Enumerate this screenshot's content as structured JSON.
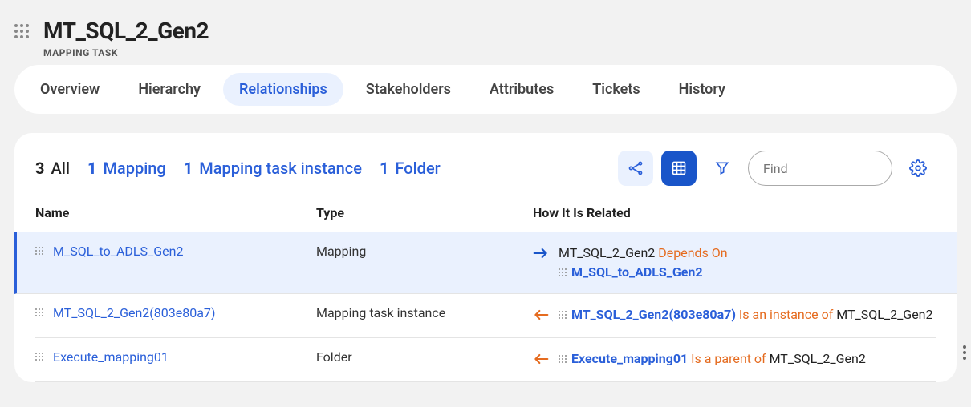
{
  "header": {
    "title": "MT_SQL_2_Gen2",
    "subtitle": "MAPPING TASK"
  },
  "tabs": [
    {
      "label": "Overview",
      "active": false
    },
    {
      "label": "Hierarchy",
      "active": false
    },
    {
      "label": "Relationships",
      "active": true
    },
    {
      "label": "Stakeholders",
      "active": false
    },
    {
      "label": "Attributes",
      "active": false
    },
    {
      "label": "Tickets",
      "active": false
    },
    {
      "label": "History",
      "active": false
    }
  ],
  "counters": [
    {
      "num": "3",
      "label": "All",
      "blue": false
    },
    {
      "num": "1",
      "label": "Mapping",
      "blue": true
    },
    {
      "num": "1",
      "label": "Mapping task instance",
      "blue": true
    },
    {
      "num": "1",
      "label": "Folder",
      "blue": true
    }
  ],
  "search": {
    "placeholder": "Find"
  },
  "columns": {
    "c1": "Name",
    "c2": "Type",
    "c3": "How It Is Related"
  },
  "rows": [
    {
      "selected": true,
      "name": "M_SQL_to_ADLS_Gen2",
      "type": "Mapping",
      "arrow": "right-blue",
      "rel_a": "MT_SQL_2_Gen2",
      "rel_verb": "Depends On",
      "rel_b": "M_SQL_to_ADLS_Gen2",
      "rel_b_link": true,
      "rel_b_dots": true
    },
    {
      "selected": false,
      "name": "MT_SQL_2_Gen2(803e80a7)",
      "type": "Mapping task instance",
      "arrow": "left-orange",
      "rel_a_dots": true,
      "rel_a_link": "MT_SQL_2_Gen2(803e80a7)",
      "rel_verb": "Is an instance of",
      "rel_b": "MT_SQL_2_Gen2"
    },
    {
      "selected": false,
      "name": "Execute_mapping01",
      "type": "Folder",
      "arrow": "left-orange",
      "rel_a_dots": true,
      "rel_a_link": "Execute_mapping01",
      "rel_verb": "Is a parent of",
      "rel_b": "MT_SQL_2_Gen2"
    }
  ]
}
